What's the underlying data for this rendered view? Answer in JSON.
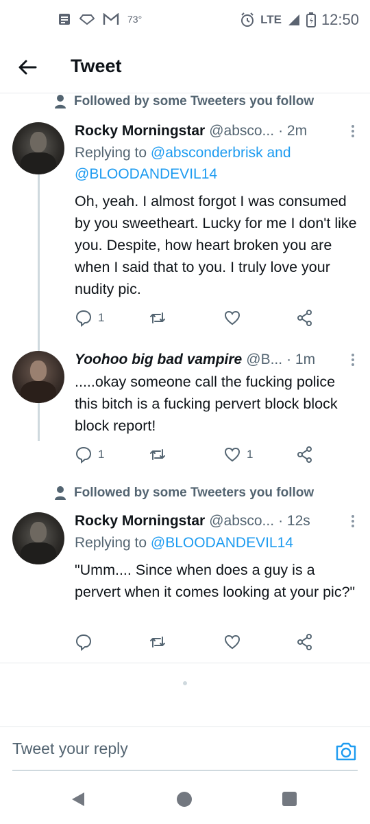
{
  "status_bar": {
    "temperature": "73°",
    "network": "LTE",
    "time": "12:50"
  },
  "header": {
    "title": "Tweet"
  },
  "thread": {
    "social_context_1": "Followed by some Tweeters you follow",
    "social_context_2": "Followed by some Tweeters you follow",
    "tweets": [
      {
        "name": "Rocky Morningstar",
        "handle": "@absco...",
        "time": "· 2m",
        "replying_prefix": "Replying to",
        "mention_1": "@absconderbrisk",
        "mention_and": "and",
        "mention_2": "@BLOODANDEVIL14",
        "text": "Oh, yeah. I almost forgot I was consumed by you sweetheart. Lucky for me I don't like you. Despite, how heart broken you are when I said that to you. I truly love your nudity pic.",
        "reply_count": "1",
        "retweet_count": "",
        "like_count": ""
      },
      {
        "name": "Yoohoo big bad vampire",
        "handle": "@B...",
        "time": "· 1m",
        "text": ".....okay someone call the fucking police this bitch is a fucking pervert block block block report!",
        "reply_count": "1",
        "retweet_count": "",
        "like_count": "1"
      },
      {
        "name": "Rocky Morningstar",
        "handle": "@absco...",
        "time": "· 12s",
        "replying_prefix": "Replying to",
        "mention_1": "@BLOODANDEVIL14",
        "text": "\"Umm.... Since when does a guy is a pervert when it comes looking at your pic?\"",
        "reply_count": "",
        "retweet_count": "",
        "like_count": ""
      }
    ]
  },
  "reply_bar": {
    "placeholder": "Tweet your reply"
  },
  "colors": {
    "accent": "#1d9bf0",
    "secondary_text": "#536471",
    "primary_text": "#0f1419"
  },
  "icons": [
    "back-arrow-icon",
    "person-icon",
    "more-vert-icon",
    "reply-icon",
    "retweet-icon",
    "like-icon",
    "share-icon",
    "camera-icon",
    "nav-back-icon",
    "nav-home-icon",
    "nav-recents-icon"
  ]
}
